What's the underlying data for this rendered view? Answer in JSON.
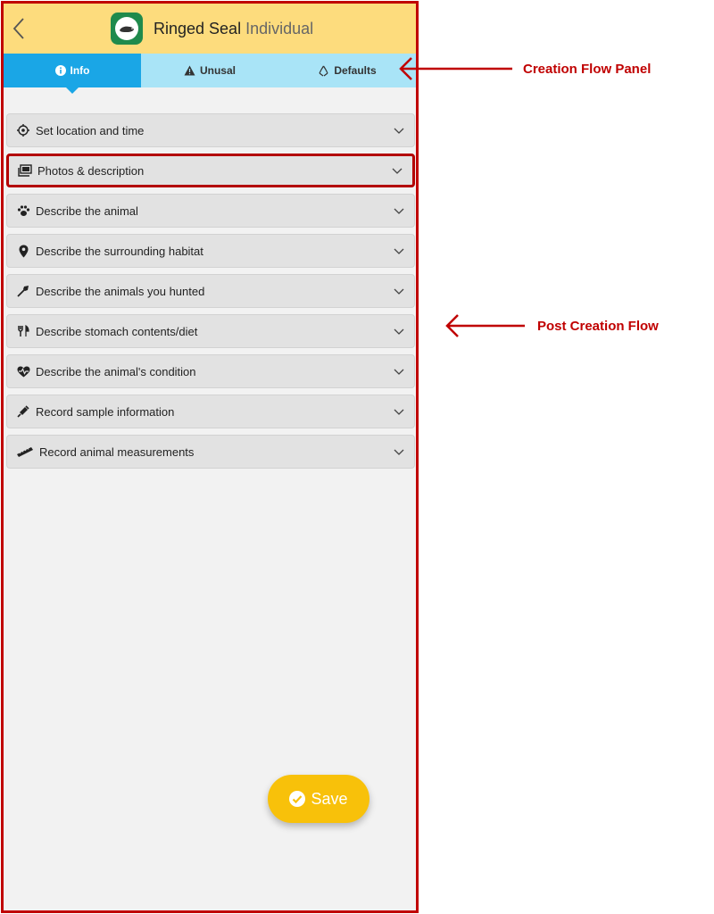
{
  "header": {
    "species_name": "Ringed Seal",
    "species_kind": "Individual"
  },
  "tabs": [
    {
      "label": "Info",
      "active": true
    },
    {
      "label": "Unusal",
      "active": false
    },
    {
      "label": "Defaults",
      "active": false
    }
  ],
  "sections": [
    {
      "label": "Set location and time",
      "icon": "location-target-icon"
    },
    {
      "label": "Photos & description",
      "icon": "photos-icon",
      "highlighted": true
    },
    {
      "label": "Describe the animal",
      "icon": "paw-icon"
    },
    {
      "label": "Describe the surrounding habitat",
      "icon": "map-pin-icon"
    },
    {
      "label": "Describe the animals you hunted",
      "icon": "harpoon-icon"
    },
    {
      "label": "Describe stomach contents/diet",
      "icon": "utensils-icon"
    },
    {
      "label": "Describe the animal's condition",
      "icon": "heartbeat-icon"
    },
    {
      "label": "Record sample information",
      "icon": "syringe-icon"
    },
    {
      "label": "Record animal measurements",
      "icon": "ruler-icon"
    }
  ],
  "save_label": "Save",
  "annotations": {
    "creation_flow_panel": "Creation Flow Panel",
    "post_creation_flow": "Post Creation Flow"
  },
  "colors": {
    "header": "#fddc7d",
    "tab_bar": "#a9e4f7",
    "tab_active": "#1aa6e6",
    "save": "#f8c10a",
    "annotation": "#c00000"
  }
}
